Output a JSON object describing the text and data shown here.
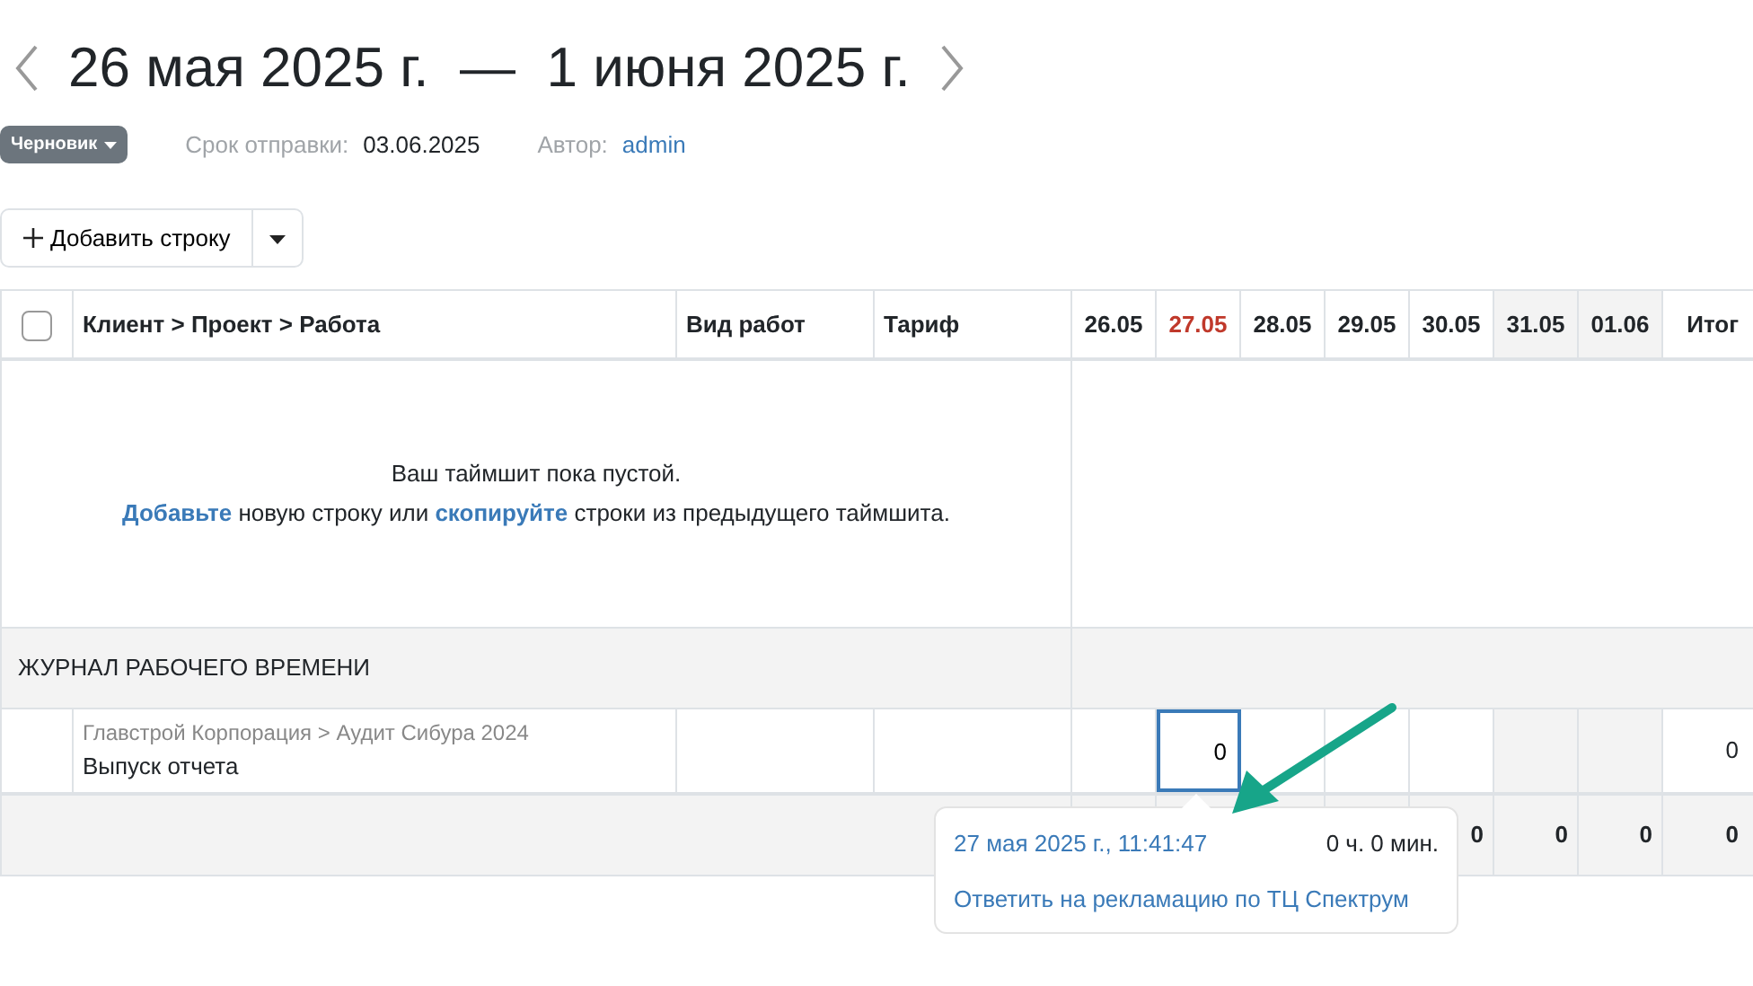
{
  "period": {
    "title": "26 мая 2025 г.  —  1 июня 2025 г."
  },
  "meta": {
    "status": "Черновик",
    "deadline_label": "Срок отправки:",
    "deadline": "03.06.2025",
    "author_label": "Автор:",
    "author": "admin"
  },
  "toolbar": {
    "add_button": "Добавить строку"
  },
  "table": {
    "select_all": {
      "checked": false
    },
    "columns": [
      "Клиент > Проект > Работа",
      "Вид работ",
      "Тариф"
    ],
    "days": [
      {
        "label": "26.05",
        "weekend": false,
        "today": false
      },
      {
        "label": "27.05",
        "weekend": false,
        "today": true
      },
      {
        "label": "28.05",
        "weekend": false,
        "today": false
      },
      {
        "label": "29.05",
        "weekend": false,
        "today": false
      },
      {
        "label": "30.05",
        "weekend": false,
        "today": false
      },
      {
        "label": "31.05",
        "weekend": true,
        "today": false
      },
      {
        "label": "01.06",
        "weekend": true,
        "today": false
      }
    ],
    "total_column": "Итог",
    "empty_message": {
      "line_1": "Ваш таймшит пока пустой.",
      "line_2": [
        {
          "kind": "link",
          "text": "Добавьте"
        },
        {
          "kind": "text",
          "text": " новую строку или "
        },
        {
          "kind": "link",
          "text": "скопируйте"
        },
        {
          "kind": "text",
          "text": " строки из предыдущего таймшита."
        }
      ]
    },
    "section": "ЖУРНАЛ РАБОЧЕГО ВРЕМЕНИ",
    "rows": [
      {
        "path": "Главстрой Корпорация > Аудит Сибура 2024",
        "task": "Выпуск отчета",
        "hours": [
          {
            "kind": "empty"
          },
          {
            "kind": "input",
            "value": "0",
            "focused": true
          },
          {
            "kind": "empty"
          },
          {
            "kind": "empty"
          },
          {
            "kind": "empty"
          },
          {
            "kind": "empty"
          },
          {
            "kind": "empty"
          }
        ],
        "total": "0"
      }
    ],
    "day_totals": [
      "0",
      "0",
      "0"
    ],
    "grand_total": "0"
  },
  "popover": {
    "datetime": "27 мая 2025 г., 11:41:47",
    "duration": "0 ч. 0 мин.",
    "comment": "Ответить на рекламацию по ТЦ Спектрум"
  }
}
